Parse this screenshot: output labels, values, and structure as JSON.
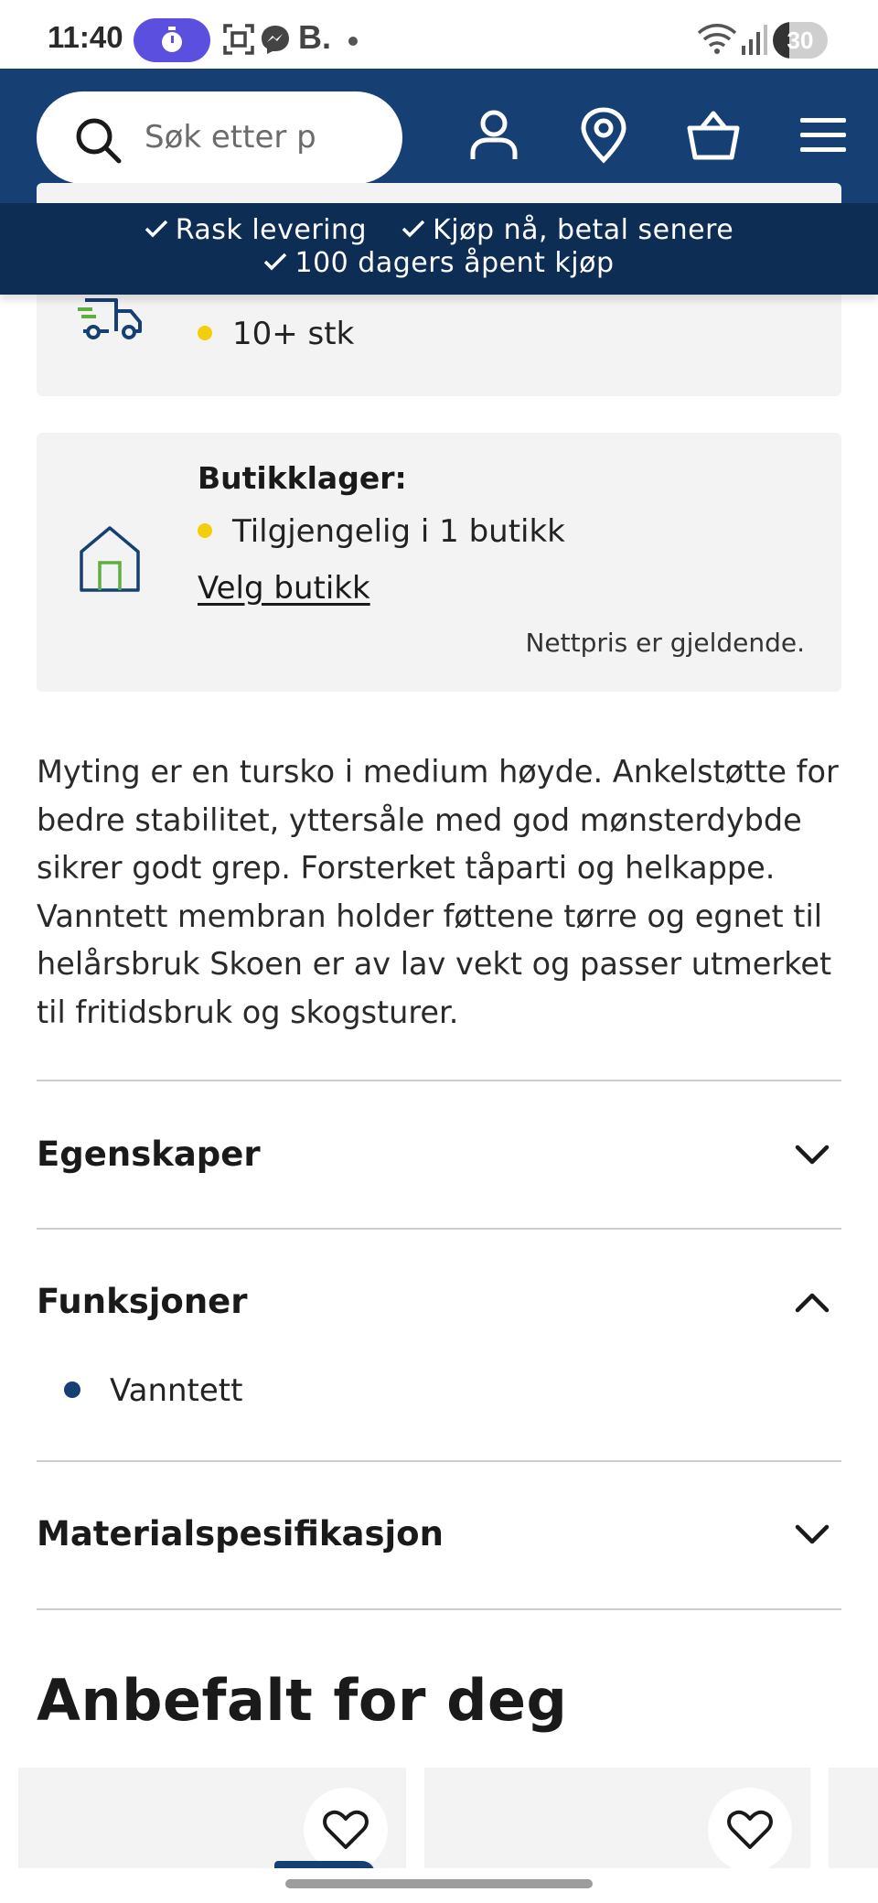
{
  "status_bar": {
    "time": "11:40",
    "notification_letter": "B.",
    "battery_level": "30",
    "battery_fraction": 0.3
  },
  "header": {
    "search_placeholder": "Søk etter p",
    "icons": [
      "search-icon",
      "account-icon",
      "location-pin-icon",
      "basket-icon",
      "menu-icon"
    ]
  },
  "usp": {
    "item1": "Rask levering",
    "item2": "Kjøp nå, betal senere",
    "item3": "100 dagers åpent kjøp"
  },
  "online_stock": {
    "quantity": "10+ stk"
  },
  "store_stock": {
    "title": "Butikklager:",
    "availability": "Tilgjengelig i 1 butikk",
    "choose_store": "Velg butikk",
    "price_note": "Nettpris er gjeldende."
  },
  "description": "Myting er en tursko i medium høyde. Ankelstøtte for bedre stabilitet, yttersåle med god mønsterdybde sikrer godt grep. Forsterket tåparti og helkappe. Vanntett membran holder føttene tørre og egnet til helårsbruk Skoen er av lav vekt og passer utmerket til fritidsbruk og skogsturer.",
  "accordion": {
    "properties": {
      "title": "Egenskaper",
      "expanded": false
    },
    "functions": {
      "title": "Funksjoner",
      "expanded": true,
      "items": [
        "Vanntett"
      ]
    },
    "materials": {
      "title": "Materialspesifikasjon",
      "expanded": false
    }
  },
  "recommendations": {
    "title": "Anbefalt for deg"
  },
  "colors": {
    "brand_blue": "#163f73",
    "usp_navy": "#0d2d55",
    "stock_yellow": "#f2cf0a",
    "card_grey": "#f3f3f3"
  }
}
